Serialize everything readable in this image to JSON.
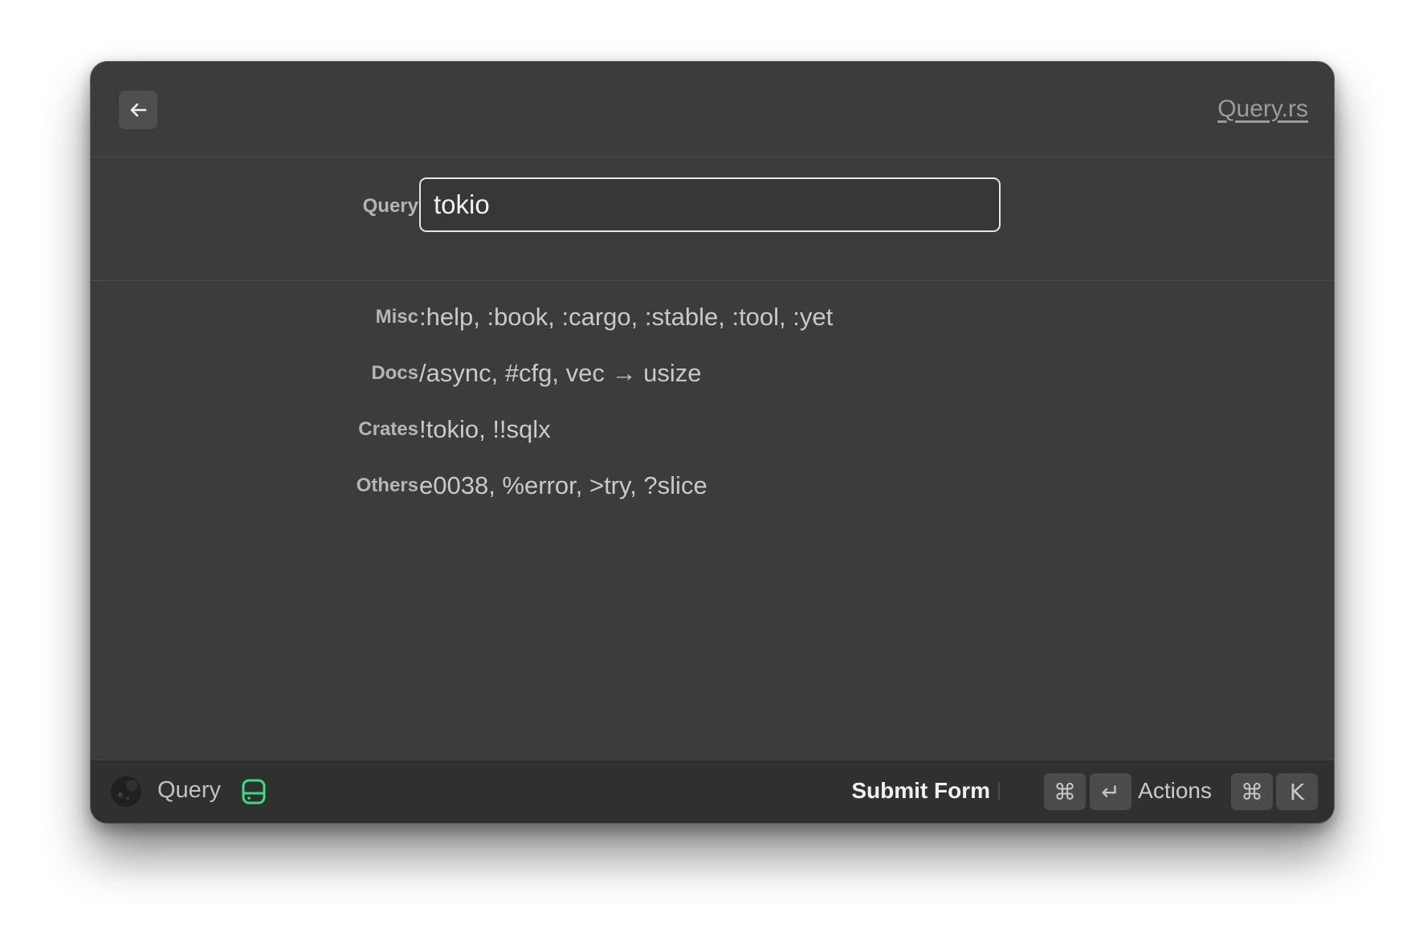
{
  "header": {
    "back_icon": "arrow-left-icon",
    "app_link": "Query.rs"
  },
  "form": {
    "query_label": "Query",
    "query_value": "tokio"
  },
  "hints": [
    {
      "label": "Misc",
      "value": ":help, :book, :cargo, :stable, :tool, :yet"
    },
    {
      "label": "Docs",
      "value": "/async, #cfg, vec → usize"
    },
    {
      "label": "Crates",
      "value": "!tokio, !!sqlx"
    },
    {
      "label": "Others",
      "value": "e0038, %error, >try, ?slice"
    }
  ],
  "footer": {
    "extension_icon": "query-rs-logo-icon",
    "title": "Query",
    "storage_icon": "storage-icon",
    "storage_icon_color": "#3ddc84",
    "primary_action": "Submit Form",
    "primary_keys": [
      "⌘",
      "↵"
    ],
    "secondary_action": "Actions",
    "secondary_keys": [
      "⌘",
      "K"
    ]
  }
}
